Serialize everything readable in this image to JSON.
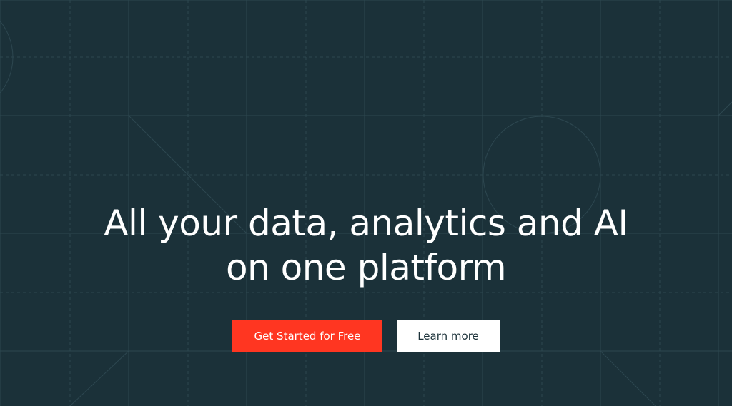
{
  "theme": {
    "background": "#1b3139",
    "grid_line": "#2d4750",
    "text": "#ffffff",
    "primary_button_bg": "#ff3621",
    "secondary_button_bg": "#ffffff",
    "secondary_button_text": "#1b3139"
  },
  "hero": {
    "headline_line_1": "All your data, analytics and AI",
    "headline_line_2": "on one platform",
    "primary_cta": "Get Started for Free",
    "secondary_cta": "Learn more"
  }
}
